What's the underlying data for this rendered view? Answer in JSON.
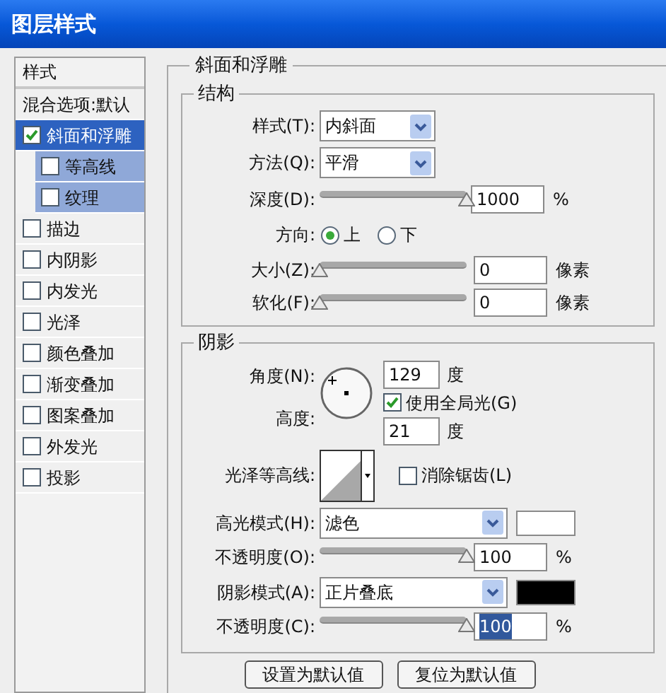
{
  "window": {
    "title": "图层样式"
  },
  "sidebar": {
    "header": "样式",
    "items": [
      {
        "label": "混合选项:默认",
        "kind": "plain",
        "selected": false
      },
      {
        "label": "斜面和浮雕",
        "kind": "checkbox",
        "checked": true,
        "selected": true,
        "children": [
          {
            "label": "等高线",
            "checked": false,
            "selected": false
          },
          {
            "label": "纹理",
            "checked": false,
            "selected": false
          }
        ]
      },
      {
        "label": "描边",
        "kind": "checkbox",
        "checked": false,
        "selected": false
      },
      {
        "label": "内阴影",
        "kind": "checkbox",
        "checked": false,
        "selected": false
      },
      {
        "label": "内发光",
        "kind": "checkbox",
        "checked": false,
        "selected": false
      },
      {
        "label": "光泽",
        "kind": "checkbox",
        "checked": false,
        "selected": false
      },
      {
        "label": "颜色叠加",
        "kind": "checkbox",
        "checked": false,
        "selected": false
      },
      {
        "label": "渐变叠加",
        "kind": "checkbox",
        "checked": false,
        "selected": false
      },
      {
        "label": "图案叠加",
        "kind": "checkbox",
        "checked": false,
        "selected": false
      },
      {
        "label": "外发光",
        "kind": "checkbox",
        "checked": false,
        "selected": false
      },
      {
        "label": "投影",
        "kind": "checkbox",
        "checked": false,
        "selected": false
      }
    ]
  },
  "panel": {
    "title": "斜面和浮雕",
    "structure": {
      "title": "结构",
      "style": {
        "label": "样式(T):",
        "value": "内斜面"
      },
      "technique": {
        "label": "方法(Q):",
        "value": "平滑"
      },
      "depth": {
        "label": "深度(D):",
        "level": 1,
        "value": "1000",
        "unit": "%"
      },
      "direction": {
        "label": "方向:",
        "options": [
          {
            "label": "上",
            "selected": true
          },
          {
            "label": "下",
            "selected": false
          }
        ]
      },
      "size": {
        "label": "大小(Z):",
        "level": 0,
        "value": "0",
        "unit": "像素"
      },
      "soften": {
        "label": "软化(F):",
        "level": 0,
        "value": "0",
        "unit": "像素"
      }
    },
    "shading": {
      "title": "阴影",
      "angle": {
        "label": "角度(N):",
        "value": "129",
        "unit": "度"
      },
      "global_light": {
        "label": "使用全局光(G)",
        "checked": true
      },
      "altitude": {
        "label": "高度:",
        "value": "21",
        "unit": "度"
      },
      "gloss_contour": {
        "label": "光泽等高线:"
      },
      "anti_aliased": {
        "label": "消除锯齿(L)",
        "checked": false
      },
      "highlight_mode": {
        "label": "高光模式(H):",
        "value": "滤色",
        "color": "#ffffff"
      },
      "highlight_opacity": {
        "label": "不透明度(O):",
        "level": 1,
        "value": "100",
        "unit": "%",
        "highlighted": false
      },
      "shadow_mode": {
        "label": "阴影模式(A):",
        "value": "正片叠底",
        "color": "#000000"
      },
      "shadow_opacity": {
        "label": "不透明度(C):",
        "level": 1,
        "value": "100",
        "unit": "%",
        "highlighted": true
      }
    },
    "buttons": [
      "设置为默认值",
      "复位为默认值"
    ]
  }
}
